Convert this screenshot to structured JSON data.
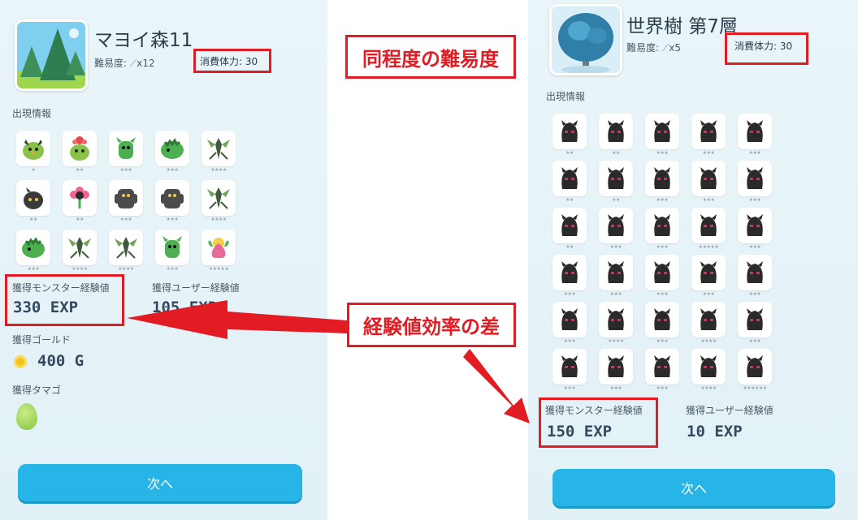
{
  "left": {
    "stage_name": "マヨイ森11",
    "difficulty_label": "難易度:",
    "difficulty_mult": "x12",
    "stamina": "消費体力: 30",
    "appearance_label": "出現情報",
    "monsters": [
      {
        "stars": "★",
        "kind": "green-bird"
      },
      {
        "stars": "★★",
        "kind": "flower-bird"
      },
      {
        "stars": "★★★",
        "kind": "green-beast"
      },
      {
        "stars": "★★★",
        "kind": "green-dino"
      },
      {
        "stars": "★★★★",
        "kind": "mantis"
      },
      {
        "stars": "★★",
        "kind": "dark-blob"
      },
      {
        "stars": "★★",
        "kind": "flower"
      },
      {
        "stars": "★★★",
        "kind": "dark-golem"
      },
      {
        "stars": "★★★",
        "kind": "dark-golem"
      },
      {
        "stars": "★★★★",
        "kind": "mantis"
      },
      {
        "stars": "★★★",
        "kind": "green-dino"
      },
      {
        "stars": "★★★★",
        "kind": "mantis"
      },
      {
        "stars": "★★★★",
        "kind": "mantis"
      },
      {
        "stars": "★★★",
        "kind": "green-beast"
      },
      {
        "stars": "★★★★★",
        "kind": "yellow-fairy"
      }
    ],
    "monster_exp_label": "獲得モンスター経験値",
    "monster_exp": "330 EXP",
    "user_exp_label": "獲得ユーザー経験値",
    "user_exp": "105 EXP",
    "gold_label": "獲得ゴールド",
    "gold": "400 G",
    "egg_label": "獲得タマゴ",
    "next": "次へ"
  },
  "right": {
    "stage_name": "世界樹 第7層",
    "difficulty_label": "難易度:",
    "difficulty_mult": "x5",
    "stamina": "消費体力: 30",
    "appearance_label": "出現情報",
    "monsters": [
      {
        "stars": "★★",
        "kind": "shadow"
      },
      {
        "stars": "★★",
        "kind": "shadow"
      },
      {
        "stars": "★★★",
        "kind": "shadow"
      },
      {
        "stars": "★★★",
        "kind": "shadow"
      },
      {
        "stars": "★★★",
        "kind": "shadow"
      },
      {
        "stars": "★★",
        "kind": "shadow"
      },
      {
        "stars": "★★",
        "kind": "shadow"
      },
      {
        "stars": "★★★",
        "kind": "shadow"
      },
      {
        "stars": "★★★",
        "kind": "shadow"
      },
      {
        "stars": "★★★",
        "kind": "shadow"
      },
      {
        "stars": "★★",
        "kind": "shadow"
      },
      {
        "stars": "★★★",
        "kind": "shadow"
      },
      {
        "stars": "★★★",
        "kind": "shadow"
      },
      {
        "stars": "★★★★★",
        "kind": "shadow"
      },
      {
        "stars": "★★★",
        "kind": "shadow"
      },
      {
        "stars": "★★★",
        "kind": "shadow"
      },
      {
        "stars": "★★★",
        "kind": "shadow"
      },
      {
        "stars": "★★★",
        "kind": "shadow"
      },
      {
        "stars": "★★★",
        "kind": "shadow"
      },
      {
        "stars": "★★★",
        "kind": "shadow"
      },
      {
        "stars": "★★★",
        "kind": "shadow"
      },
      {
        "stars": "★★★★",
        "kind": "shadow"
      },
      {
        "stars": "★★★",
        "kind": "shadow"
      },
      {
        "stars": "★★★★",
        "kind": "shadow"
      },
      {
        "stars": "★★★",
        "kind": "shadow"
      },
      {
        "stars": "★★★",
        "kind": "shadow"
      },
      {
        "stars": "★★★",
        "kind": "shadow"
      },
      {
        "stars": "★★★",
        "kind": "shadow"
      },
      {
        "stars": "★★★★",
        "kind": "shadow"
      },
      {
        "stars": "★★★★★★",
        "kind": "shadow"
      }
    ],
    "monster_exp_label": "獲得モンスター経験値",
    "monster_exp": "150 EXP",
    "user_exp_label": "獲得ユーザー経験値",
    "user_exp": "10 EXP",
    "next": "次へ"
  },
  "annotations": {
    "same_difficulty": "同程度の難易度",
    "exp_diff": "経験値効率の差"
  },
  "colors": {
    "accent": "#27b4e6",
    "annotation_red": "#e31b23",
    "monster_green": "#7cc04b",
    "shadow_dark": "#2a2a2a",
    "shadow_eye": "#e2285c"
  }
}
